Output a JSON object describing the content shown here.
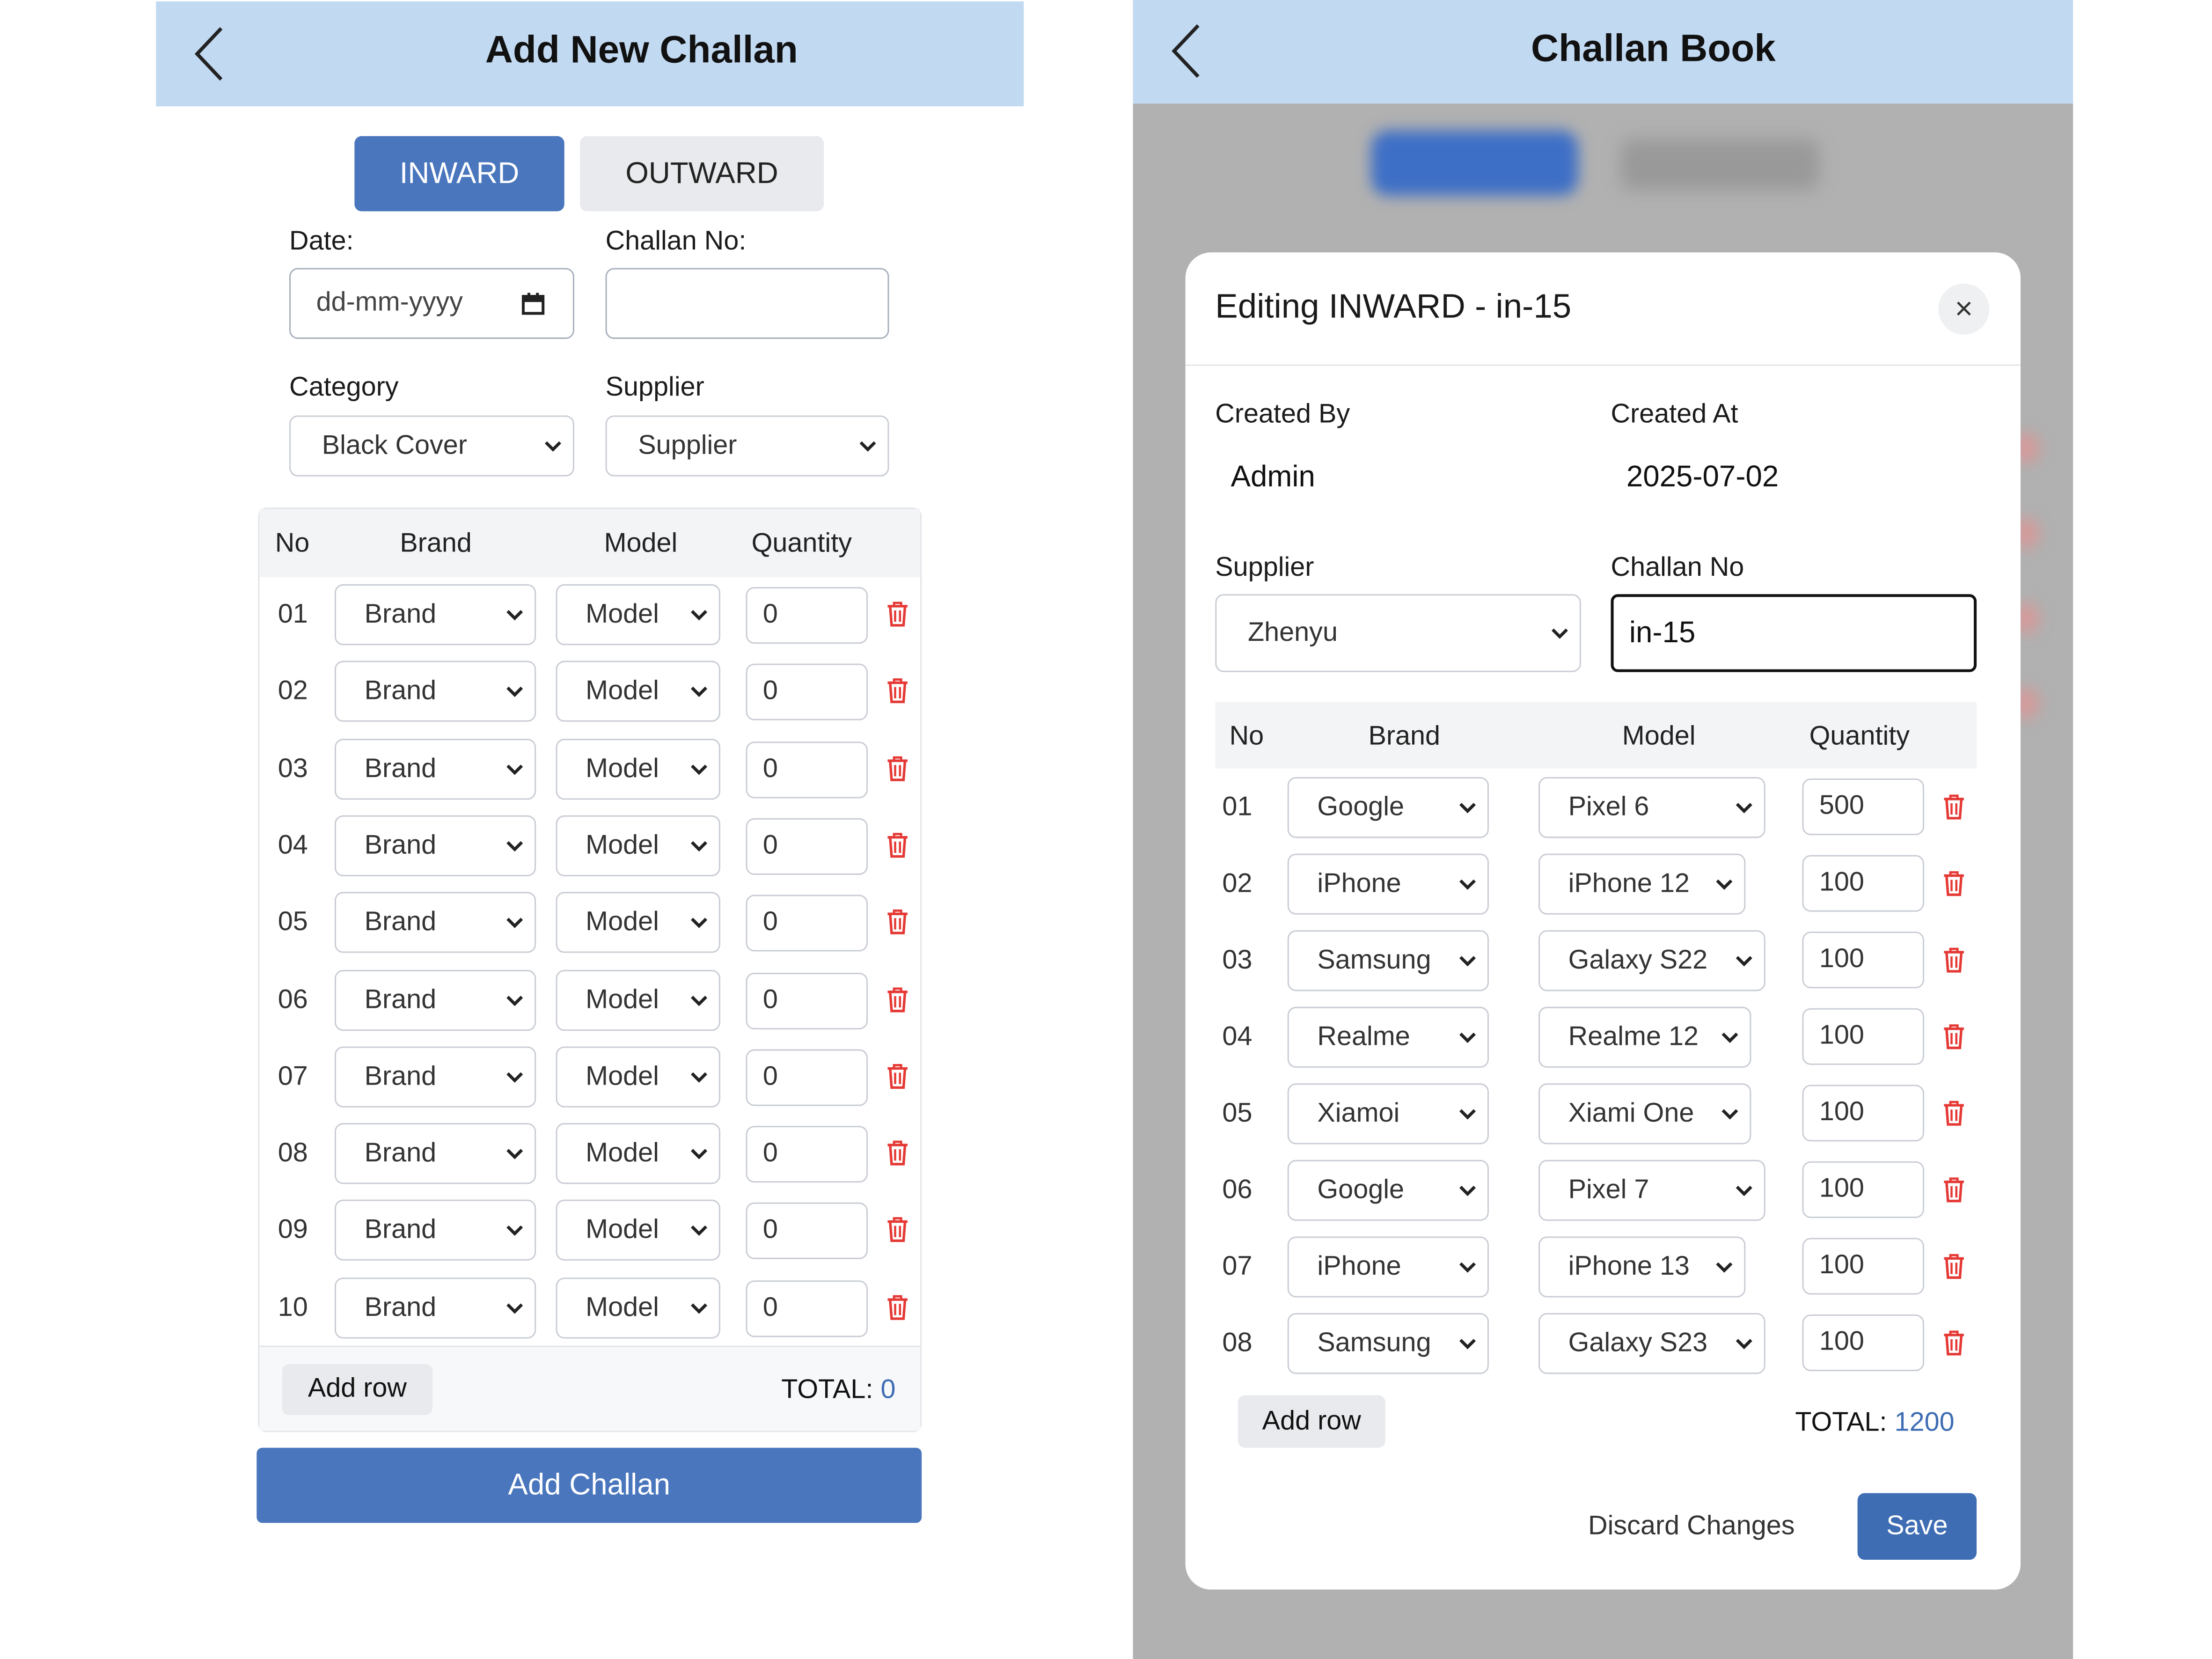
{
  "left": {
    "title": "Add New Challan",
    "tabs": [
      "INWARD",
      "OUTWARD"
    ],
    "date_label": "Date:",
    "date_placeholder": "dd-mm-yyyy",
    "challan_label": "Challan No:",
    "category_label": "Category",
    "category_value": "Black Cover",
    "supplier_label": "Supplier",
    "supplier_value": "Supplier",
    "headers": [
      "No",
      "Brand",
      "Model",
      "Quantity"
    ],
    "rows": [
      {
        "no": "01",
        "brand": "Brand",
        "model": "Model",
        "qty": "0"
      },
      {
        "no": "02",
        "brand": "Brand",
        "model": "Model",
        "qty": "0"
      },
      {
        "no": "03",
        "brand": "Brand",
        "model": "Model",
        "qty": "0"
      },
      {
        "no": "04",
        "brand": "Brand",
        "model": "Model",
        "qty": "0"
      },
      {
        "no": "05",
        "brand": "Brand",
        "model": "Model",
        "qty": "0"
      },
      {
        "no": "06",
        "brand": "Brand",
        "model": "Model",
        "qty": "0"
      },
      {
        "no": "07",
        "brand": "Brand",
        "model": "Model",
        "qty": "0"
      },
      {
        "no": "08",
        "brand": "Brand",
        "model": "Model",
        "qty": "0"
      },
      {
        "no": "09",
        "brand": "Brand",
        "model": "Model",
        "qty": "0"
      },
      {
        "no": "10",
        "brand": "Brand",
        "model": "Model",
        "qty": "0"
      }
    ],
    "add_row": "Add row",
    "total_label": "TOTAL:",
    "total_value": "0",
    "submit": "Add Challan"
  },
  "right": {
    "title": "Challan Book",
    "modal": {
      "title": "Editing INWARD - in-15",
      "close": "×",
      "created_by_label": "Created By",
      "created_by": "Admin",
      "created_at_label": "Created At",
      "created_at": "2025-07-02",
      "supplier_label": "Supplier",
      "supplier_value": "Zhenyu",
      "challan_label": "Challan No",
      "challan_value": "in-15",
      "headers": [
        "No",
        "Brand",
        "Model",
        "Quantity"
      ],
      "rows": [
        {
          "no": "01",
          "brand": "Google",
          "model": "Pixel 6",
          "qty": "500"
        },
        {
          "no": "02",
          "brand": "iPhone",
          "model": "iPhone 12",
          "qty": "100"
        },
        {
          "no": "03",
          "brand": "Samsung",
          "model": "Galaxy S22",
          "qty": "100"
        },
        {
          "no": "04",
          "brand": "Realme",
          "model": "Realme 12",
          "qty": "100"
        },
        {
          "no": "05",
          "brand": "Xiamoi",
          "model": "Xiami One",
          "qty": "100"
        },
        {
          "no": "06",
          "brand": "Google",
          "model": "Pixel 7",
          "qty": "100"
        },
        {
          "no": "07",
          "brand": "iPhone",
          "model": "iPhone 13",
          "qty": "100"
        },
        {
          "no": "08",
          "brand": "Samsung",
          "model": "Galaxy S23",
          "qty": "100"
        }
      ],
      "add_row": "Add row",
      "total_label": "TOTAL:",
      "total_value": "1200",
      "discard": "Discard Changes",
      "save": "Save"
    }
  },
  "colors": {
    "header_bg": "#c1d9f1",
    "primary": "#4a76bd",
    "accent_text": "#3e6db4",
    "danger": "#e53935",
    "overlay": "#b1b1b1"
  }
}
